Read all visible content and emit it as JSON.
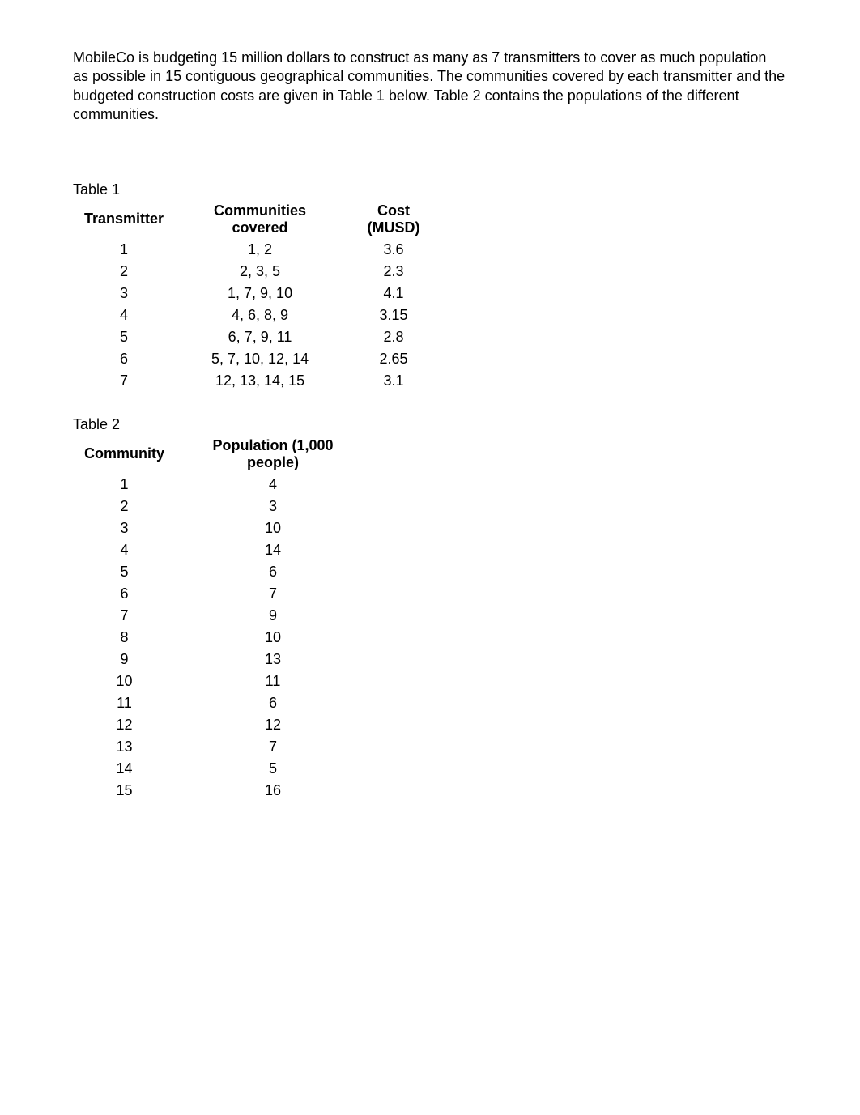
{
  "intro": "MobileCo is budgeting 15 million dollars to construct as many as 7 transmitters to cover as much population as possible in 15 contiguous geographical communities. The communities covered by each transmitter and the budgeted construction costs are given in Table 1 below.  Table 2 contains the populations of the different communities.",
  "table1": {
    "caption": "Table 1",
    "headers": {
      "transmitter": "Transmitter",
      "communities": "Communities covered",
      "cost": "Cost (MUSD)"
    },
    "rows": [
      {
        "transmitter": "1",
        "communities": "1, 2",
        "cost": "3.6"
      },
      {
        "transmitter": "2",
        "communities": "2, 3, 5",
        "cost": "2.3"
      },
      {
        "transmitter": "3",
        "communities": "1, 7, 9, 10",
        "cost": "4.1"
      },
      {
        "transmitter": "4",
        "communities": "4, 6, 8, 9",
        "cost": "3.15"
      },
      {
        "transmitter": "5",
        "communities": "6, 7, 9, 11",
        "cost": "2.8"
      },
      {
        "transmitter": "6",
        "communities": "5, 7, 10, 12, 14",
        "cost": "2.65"
      },
      {
        "transmitter": "7",
        "communities": "12, 13, 14, 15",
        "cost": "3.1"
      }
    ]
  },
  "table2": {
    "caption": "Table 2",
    "headers": {
      "community": "Community",
      "population": "Population (1,000 people)"
    },
    "rows": [
      {
        "community": "1",
        "population": "4"
      },
      {
        "community": "2",
        "population": "3"
      },
      {
        "community": "3",
        "population": "10"
      },
      {
        "community": "4",
        "population": "14"
      },
      {
        "community": "5",
        "population": "6"
      },
      {
        "community": "6",
        "population": "7"
      },
      {
        "community": "7",
        "population": "9"
      },
      {
        "community": "8",
        "population": "10"
      },
      {
        "community": "9",
        "population": "13"
      },
      {
        "community": "10",
        "population": "11"
      },
      {
        "community": "11",
        "population": "6"
      },
      {
        "community": "12",
        "population": "12"
      },
      {
        "community": "13",
        "population": "7"
      },
      {
        "community": "14",
        "population": "5"
      },
      {
        "community": "15",
        "population": "16"
      }
    ]
  }
}
